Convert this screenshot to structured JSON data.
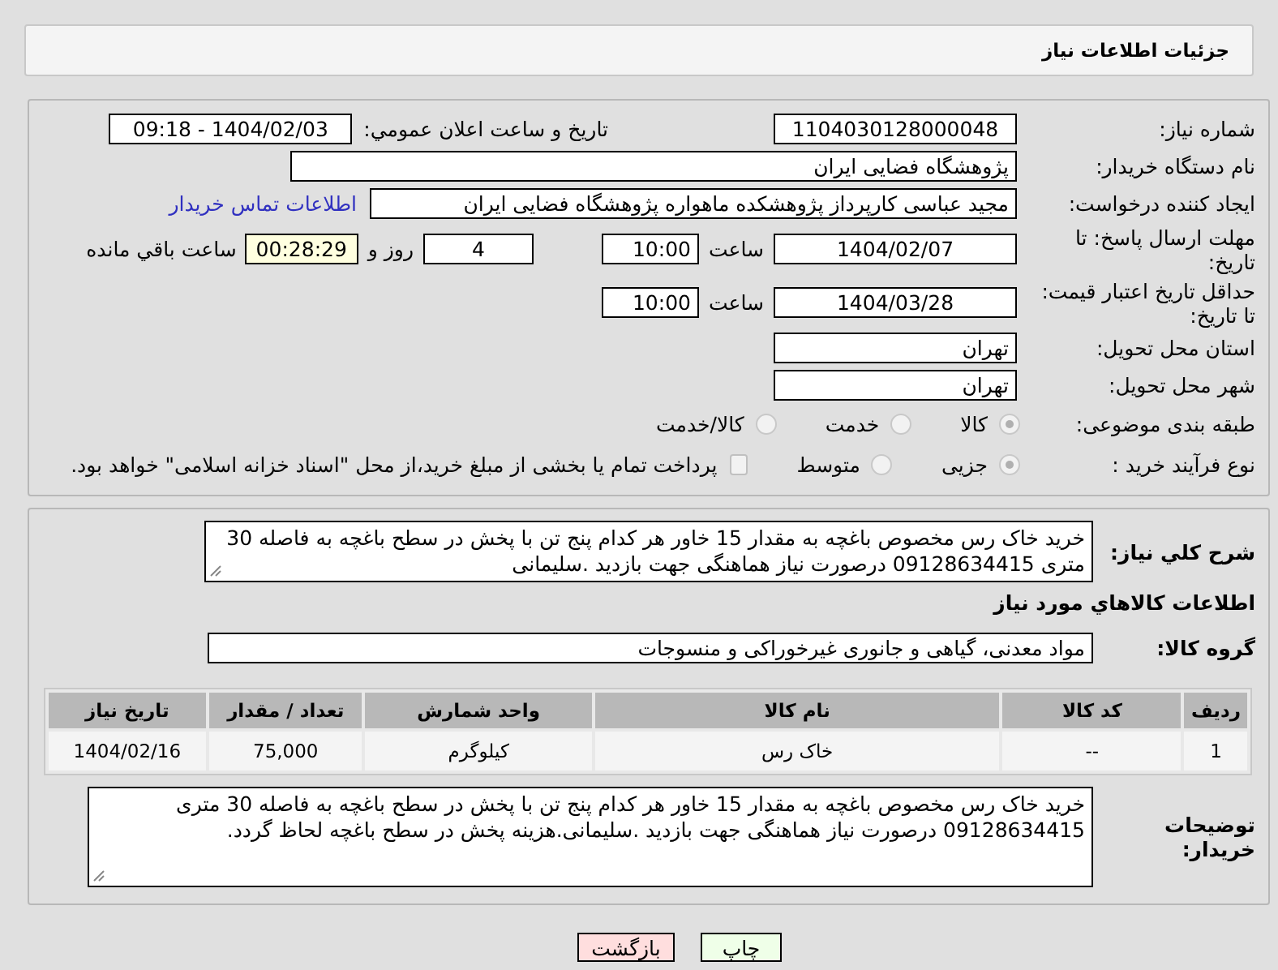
{
  "header": {
    "title": "جزئیات اطلاعات نیاز"
  },
  "need_number": {
    "label": "شماره نیاز:",
    "value": "1104030128000048"
  },
  "announce": {
    "label": "تاریخ و ساعت اعلان عمومي:",
    "value": "1404/02/03 - 09:18"
  },
  "buyer": {
    "label": "نام دستگاه خریدار:",
    "value": "پژوهشگاه فضایی ایران"
  },
  "creator": {
    "label": "ایجاد کننده درخواست:",
    "value": "مجید عباسی کارپرداز پژوهشکده ماهواره پژوهشگاه فضایی ایران",
    "link": "اطلاعات تماس خریدار"
  },
  "deadline": {
    "label": "مهلت ارسال پاسخ: تا تاریخ:",
    "date": "1404/02/07",
    "time_label": "ساعت",
    "time": "10:00",
    "days": "4",
    "days_label": "روز و",
    "remaining": "00:28:29",
    "remaining_label": "ساعت باقي مانده"
  },
  "validity": {
    "label": "حداقل تاریخ اعتبار قیمت: تا تاریخ:",
    "date": "1404/03/28",
    "time_label": "ساعت",
    "time": "10:00"
  },
  "province": {
    "label": "استان محل تحویل:",
    "value": "تهران"
  },
  "city": {
    "label": "شهر محل تحویل:",
    "value": "تهران"
  },
  "category": {
    "label": "طبقه بندی موضوعی:",
    "options": [
      {
        "label": "کالا",
        "selected": true
      },
      {
        "label": "خدمت",
        "selected": false
      },
      {
        "label": "کالا/خدمت",
        "selected": false
      }
    ]
  },
  "process": {
    "label": "نوع فرآیند خرید :",
    "options": [
      {
        "label": "جزیی",
        "selected": true
      },
      {
        "label": "متوسط",
        "selected": false
      }
    ],
    "treasury": {
      "checked": false,
      "text": "پرداخت تمام یا بخشی از مبلغ خرید،از محل \"اسناد خزانه اسلامی\" خواهد بود."
    }
  },
  "description": {
    "label": "شرح کلي نياز:",
    "value": "خرید خاک رس مخصوص باغچه به مقدار 15 خاور هر کدام پنج تن با پخش در سطح باغچه به فاصله 30 متری 09128634415 درصورت نیاز هماهنگی جهت بازدید .سلیمانی"
  },
  "goods_heading": "اطلاعات کالاهاي مورد نياز",
  "goods_group": {
    "label": "گروه کالا:",
    "value": "مواد معدنی، گیاهی و جانوری غیرخوراکی و منسوجات"
  },
  "table": {
    "columns": [
      "رديف",
      "کد کالا",
      "نام کالا",
      "واحد شمارش",
      "تعداد / مقدار",
      "تاریخ نیاز"
    ],
    "rows": [
      [
        "1",
        "--",
        "خاک رس",
        "کیلوگرم",
        "75,000",
        "1404/02/16"
      ]
    ]
  },
  "notes": {
    "label": "توضیحات خریدار:",
    "value": "خرید خاک رس مخصوص باغچه به مقدار 15 خاور هر کدام پنج تن با پخش در سطح باغچه به فاصله 30 متری 09128634415 درصورت نیاز هماهنگی جهت بازدید .سلیمانی.هزینه پخش در سطح باغچه لحاظ گردد."
  },
  "buttons": [
    {
      "label": "چاپ",
      "kind": "print"
    },
    {
      "label": "بازگشت",
      "kind": "back"
    }
  ]
}
